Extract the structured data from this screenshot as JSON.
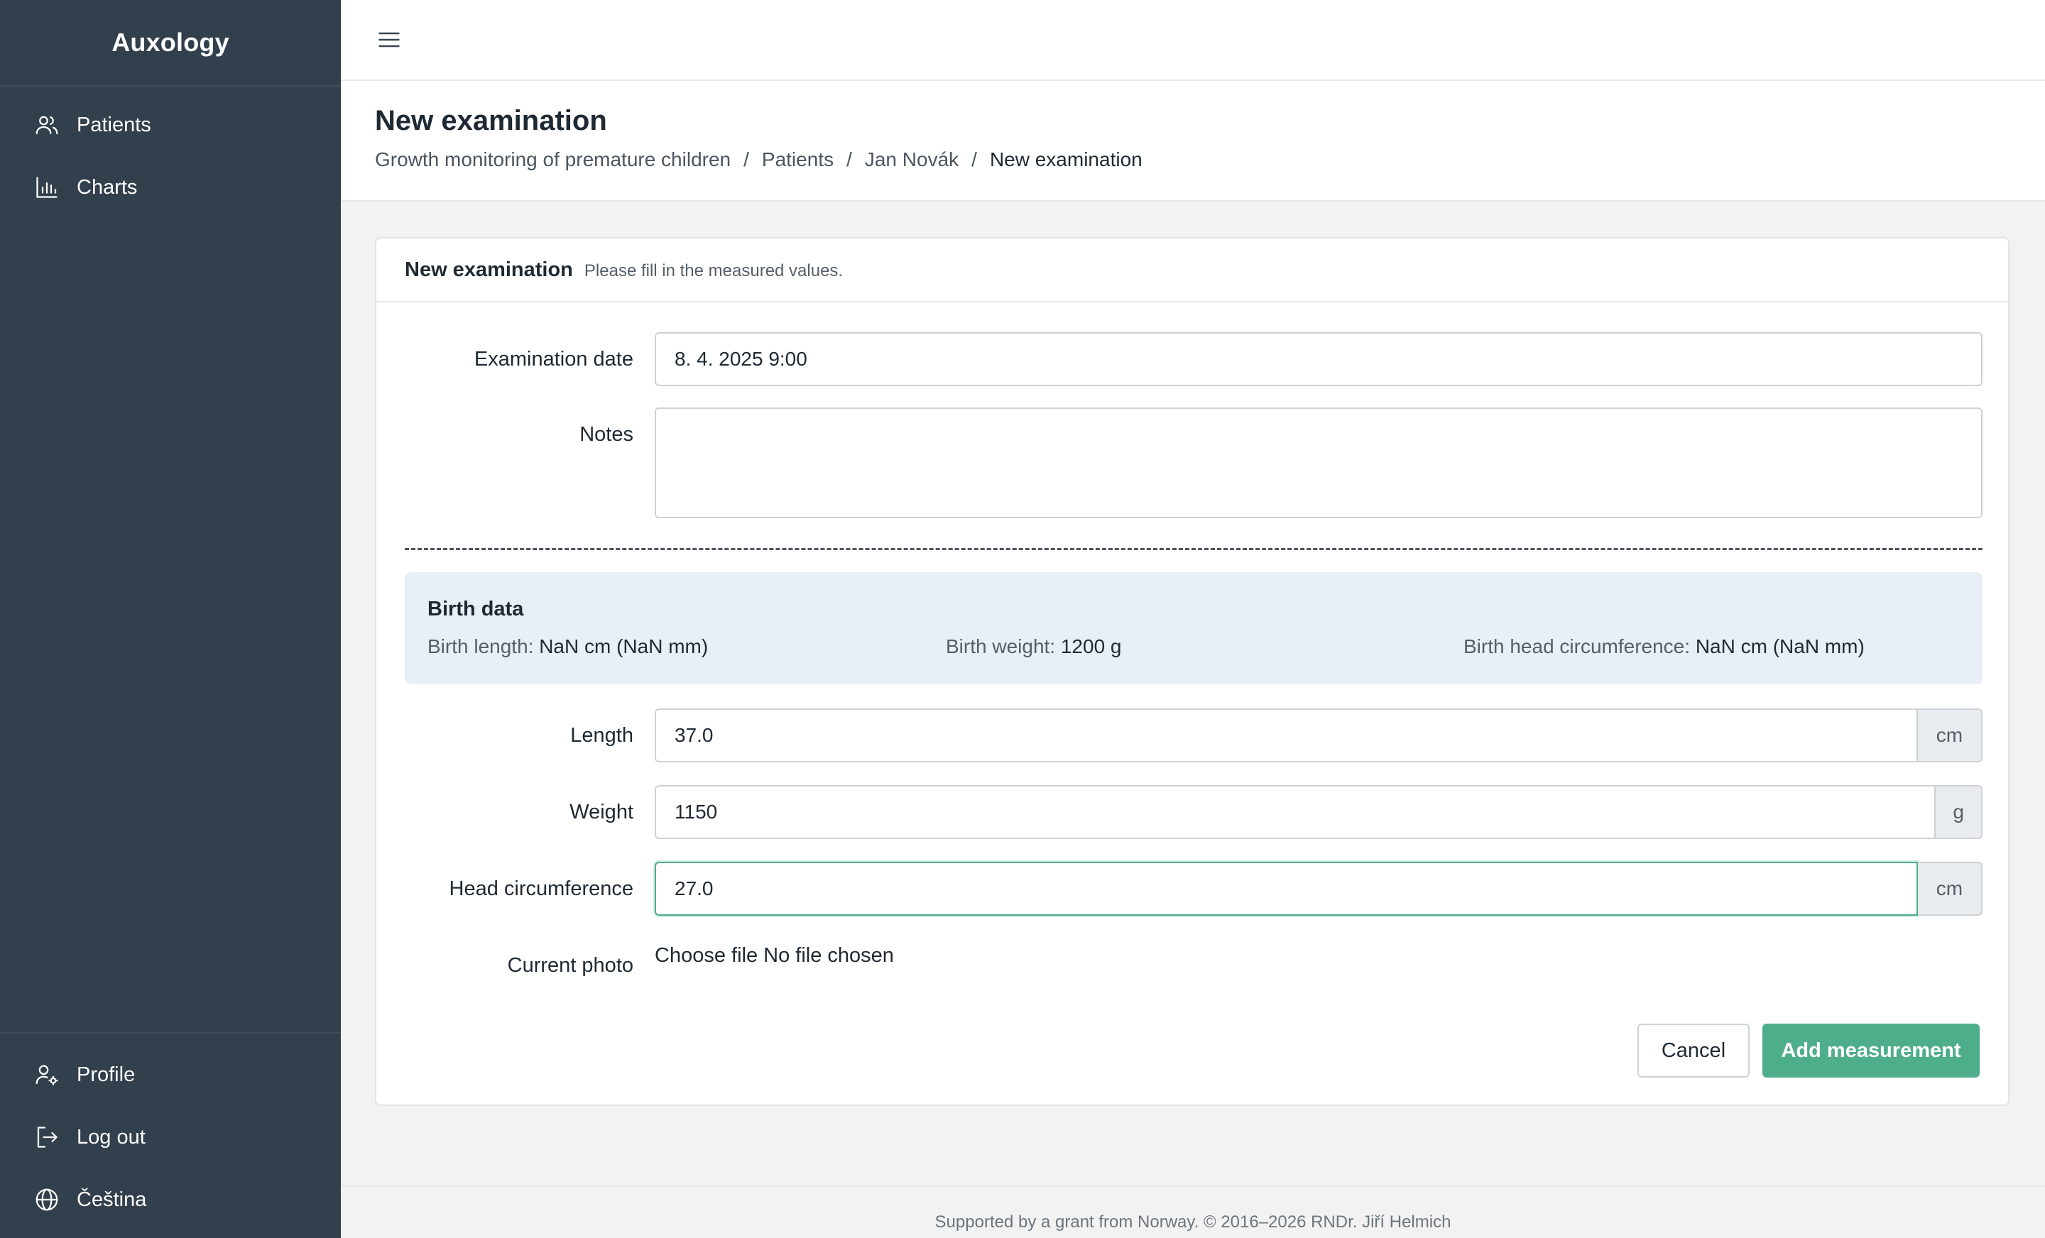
{
  "app": {
    "title": "Auxology"
  },
  "sidebar": {
    "items": [
      {
        "label": "Patients",
        "icon": "users-icon"
      },
      {
        "label": "Charts",
        "icon": "bar-chart-icon"
      }
    ],
    "bottom_items": [
      {
        "label": "Profile",
        "icon": "user-gear-icon"
      },
      {
        "label": "Log out",
        "icon": "logout-icon"
      },
      {
        "label": "Čeština",
        "icon": "globe-icon"
      }
    ]
  },
  "header": {
    "title": "New examination",
    "breadcrumb": [
      "Growth monitoring of premature children",
      "Patients",
      "Jan Novák",
      "New examination"
    ]
  },
  "card": {
    "title": "New examination",
    "subtitle": "Please fill in the measured values."
  },
  "form": {
    "exam_date": {
      "label": "Examination date",
      "value": "8. 4. 2025 9:00"
    },
    "notes": {
      "label": "Notes",
      "value": ""
    },
    "birth": {
      "title": "Birth data",
      "length_label": "Birth length:",
      "length_value": "NaN cm (NaN mm)",
      "weight_label": "Birth weight:",
      "weight_value": "1200 g",
      "head_label": "Birth head circumference:",
      "head_value": "NaN cm (NaN mm)"
    },
    "length": {
      "label": "Length",
      "value": "37.0",
      "unit": "cm"
    },
    "weight": {
      "label": "Weight",
      "value": "1150",
      "unit": "g"
    },
    "head": {
      "label": "Head circumference",
      "value": "27.0",
      "unit": "cm"
    },
    "photo": {
      "label": "Current photo",
      "button": "Choose file",
      "status": "No file chosen"
    },
    "cancel_label": "Cancel",
    "submit_label": "Add measurement"
  },
  "footer": {
    "text": "Supported by a grant from Norway. © 2016–2026 RNDr. Jiří Helmich"
  },
  "colors": {
    "sidebar_bg": "#323f4c",
    "primary": "#4fae8a",
    "birth_box_bg": "#e8eff6"
  }
}
